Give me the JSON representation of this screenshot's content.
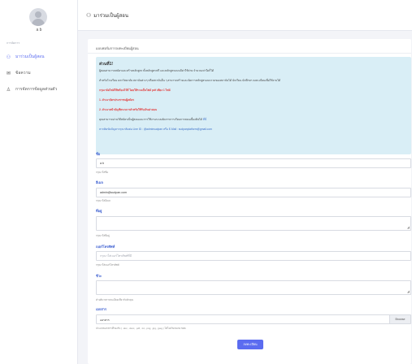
{
  "sidebar": {
    "user_name": "a b",
    "nav_heading": "การจัดการ",
    "items": [
      {
        "label": "มาร่วมเป็นผู้สอน",
        "icon": "user-add-icon",
        "active": true
      },
      {
        "label": "ข้อความ",
        "icon": "mail-icon",
        "active": false
      },
      {
        "label": "การจัดการข้อมูลส่วนตัว",
        "icon": "person-icon",
        "active": false
      }
    ]
  },
  "header": {
    "title": "มาร่วมเป็นผู้สอน",
    "icon": "user-add-icon"
  },
  "card": {
    "title": "แบบฟอร์มการลงทะเบียนผู้สอน"
  },
  "info": {
    "heading": "ส่วนที่1!",
    "line1": "ผู้สอนสามารถสมัครและสร้างหลักสูตร ทั้งหลักสูตรฟรี และหลักสูตรแบบมีค่าใช้จ่าย จำนวนเท่าใดก็ได้",
    "line2": "สำหรับโรงเรียน มหาวิทยาลัย สถาบันต่างๆ หรือสถาบันอื่น ๆ สามารถสร้างและจัดการหลักสูตรแบบรวมของสถาบันได้ นักเรียน นักศึกษา ลงทะเบียนเพื่อใช้งานได้",
    "line3": "กรุณาจัดไฟล์ให้พร้อมไว้ที่ โดยให้รวมเป็นไฟล์ pdf เพียง 1 ไฟล์",
    "line4": "1. สำเนาบัตรประชาชนผู้สมัคร",
    "line5": "2. สำเนาหน้าบัญชีธนาคารสำหรับใช้รับเงินค่าสอน",
    "line6_prefix": "คุณสามารถอ่านวิธีสมัครเป็นผู้สอนและการใช้งานระบบจัดการการเรียนการสอนเบื้องต้นได้",
    "line6_link": "ที่นี่",
    "line7": "หากติดขัดปัญหากรุณาติดต่อ Line ID : @adminsudpan หรือ E-Mail : sudpanplatform@gmail.com"
  },
  "form": {
    "name_label": "ชื่อ",
    "name_value": "a b",
    "name_help": "กรุณาใส่ชื่อ",
    "email_label": "อีเมล",
    "email_value": "admin@sudpan.com",
    "email_help": "กรุณาใส่อีเมล",
    "address_label": "ที่อยู่",
    "address_help": "กรุณาใส่ที่อยู่",
    "phone_label": "เบอร์โทรศัพท์",
    "phone_placeholder": "กรุณาใส่เบอร์โทรศัพท์ที่มี",
    "phone_help": "กรุณาใส่เบอร์โทรศัพท์",
    "detail_label": "ชีวะ",
    "detail_help": "คำอธิบายรายละเอียดเกี่ยวกับตัวคุณ",
    "file_label": "เอกสาร",
    "file_value": "เอกสาร",
    "browse_label": "Browse",
    "file_help": "ประเภทเอกสารที่รองรับ ( .doc, .docx, .pdf, .txt, .png, .jpg, .jpeg ) ได้ไม่เกินขนาด 5Mb",
    "submit_label": "ลงทะเบียน"
  },
  "colors": {
    "accent": "#5b6cf0",
    "info_bg": "#d9eef6",
    "warning_text": "#e23b3b"
  }
}
